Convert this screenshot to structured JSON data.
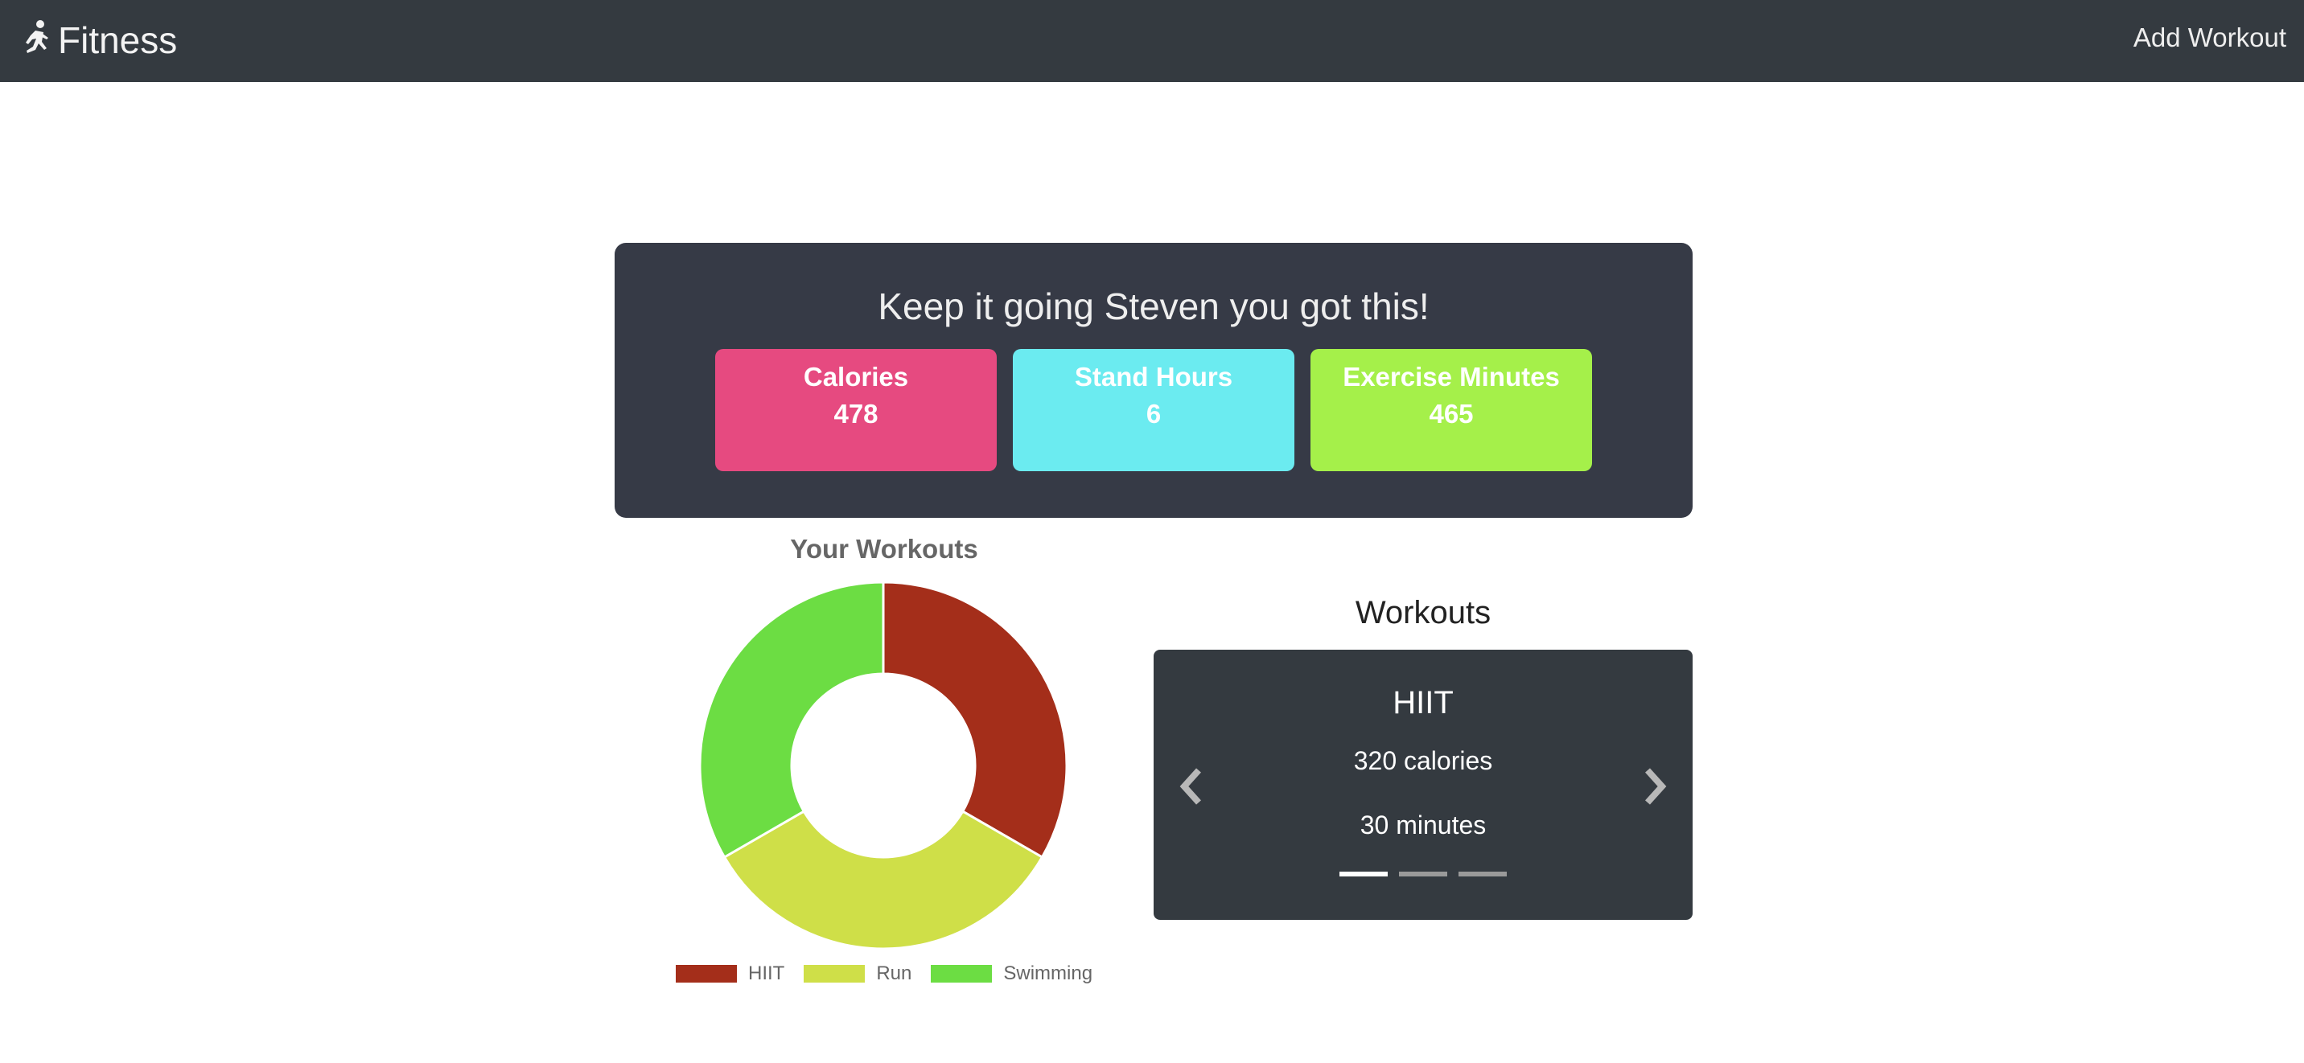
{
  "navbar": {
    "brand": "Fitness",
    "brand_icon": "running-person-icon",
    "add_workout": "Add Workout"
  },
  "summary": {
    "title": "Keep it going Steven you got this!",
    "stats": [
      {
        "label": "Calories",
        "value": "478",
        "color": "#e64a80"
      },
      {
        "label": "Stand Hours",
        "value": "6",
        "color": "#6bebf0"
      },
      {
        "label": "Exercise Minutes",
        "value": "465",
        "color": "#a5f04a"
      }
    ]
  },
  "chart_data": {
    "type": "pie",
    "title": "Your Workouts",
    "categories": [
      "HIIT",
      "Run",
      "Swimming"
    ],
    "values": [
      1,
      1,
      1
    ],
    "colors": [
      "#a42e1a",
      "#cfdf48",
      "#6cdd43"
    ],
    "legend": "bottom"
  },
  "carousel": {
    "heading": "Workouts",
    "slide": {
      "title": "HIIT",
      "calories": "320 calories",
      "minutes": "30 minutes"
    },
    "indicator_count": 3,
    "active_index": 0
  }
}
